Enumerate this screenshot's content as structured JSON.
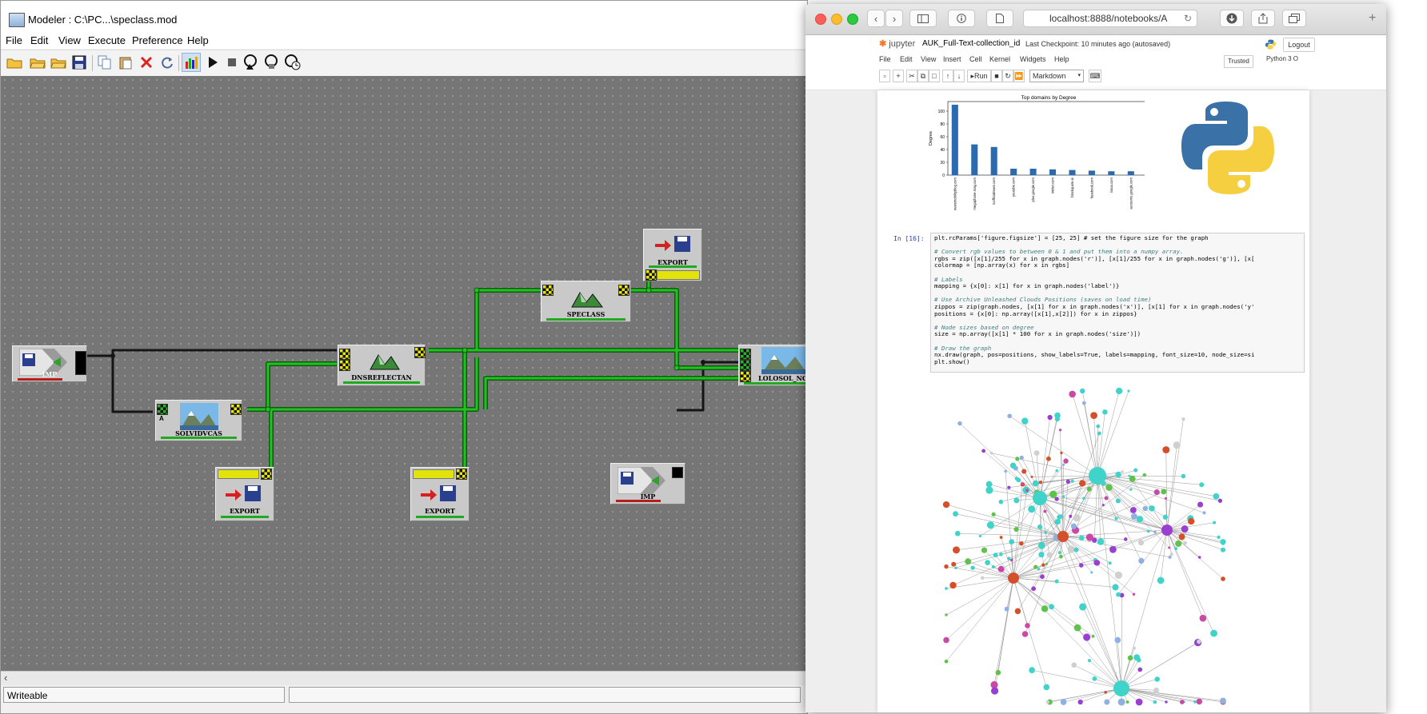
{
  "modeler": {
    "title": "Modeler : C:\\PC...\\speclass.mod",
    "menu": [
      "File",
      "Edit",
      "View",
      "Execute",
      "Preference",
      "Help"
    ],
    "toolbar_icons": [
      "new-folder-icon",
      "open-folder-icon",
      "open-folder-alt-icon",
      "save-icon",
      "copy-icon",
      "paste-icon",
      "delete-icon",
      "refresh-icon",
      "chart-icon",
      "run-icon",
      "stop-icon",
      "loop-run-icon",
      "loop-stop-icon",
      "loop-clock-icon"
    ],
    "nodes": {
      "import1": "IMP",
      "solvidvcas": "SOLVIDVCAS",
      "dnsreflectan": "DNSREFLECTAN",
      "speclass": "SPECLASS",
      "export_top": "EXPORT",
      "import2": "IMP",
      "lolosol_nomi": "LOLOSOL_NOMI",
      "export_left": "EXPORT",
      "export_mid": "EXPORT"
    },
    "port_a_label": "A",
    "status": "Writeable",
    "colors": {
      "canvas": "#767676",
      "wire_green": "#22c022",
      "wire_black": "#151515"
    }
  },
  "browser": {
    "url": "localhost:8888/notebooks/A",
    "jupyter": {
      "logo": "jupyter",
      "notebook_name": "AUK_Full-Text-collection_id",
      "checkpoint": "Last Checkpoint: 10 minutes ago (autosaved)",
      "logout": "Logout",
      "menu": [
        "File",
        "Edit",
        "View",
        "Insert",
        "Cell",
        "Kernel",
        "Widgets",
        "Help"
      ],
      "trusted": "Trusted",
      "kernel": "Python 3 O",
      "run_label": "Run",
      "cell_type": "Markdown",
      "prompt": "In [16]:",
      "code": [
        "plt.rcParams['figure.figsize'] = [25, 25] # set the figure size for the graph",
        "",
        "# Convert rgb values to between 0 & 1 and put them into a numpy array.",
        "rgbs = zip([x[1]/255 for x in graph.nodes('r')], [x[1]/255 for x in graph.nodes('g')], [x[",
        "colormap = [np.array(x) for x in rgbs]",
        "",
        "# Labels",
        "mapping = {x[0]: x[1] for x in graph.nodes('label')}",
        "",
        "# Use Archive Unleashed Clouds Positions (saves on load time)",
        "zippos = zip(graph.nodes, [x[1] for x in graph.nodes('x')], [x[1] for x in graph.nodes('y'",
        "positions = {x[0]: np.array([x[1],x[2]]) for x in zippos}",
        "",
        "# Node sizes based on degree",
        "size = np.array([x[1] * 100 for x in graph.nodes('size')])",
        "",
        "# Draw the graph",
        "nx.draw(graph, pos=positions, show_labels=True, labels=mapping, font_size=10, node_size=si",
        "plt.show()"
      ]
    }
  },
  "chart_data": {
    "type": "bar",
    "title": "Top domains by Degree",
    "xlabel": "",
    "ylabel": "Degree",
    "ylim": [
      0,
      115
    ],
    "yticks": [
      0,
      20,
      40,
      60,
      80,
      100
    ],
    "categories": [
      "newsmobilityblog.com",
      "megaphone.mag.com",
      "tcofficialnews.com",
      "youtube.com",
      "plus.google.com",
      "twitter.com",
      "blockquote.io",
      "facebook.com",
      "issuu.com",
      "accounts.google.com"
    ],
    "values": [
      110,
      48,
      44,
      10,
      10,
      9,
      8,
      7,
      6,
      6
    ],
    "color": "#2a6bb0"
  }
}
